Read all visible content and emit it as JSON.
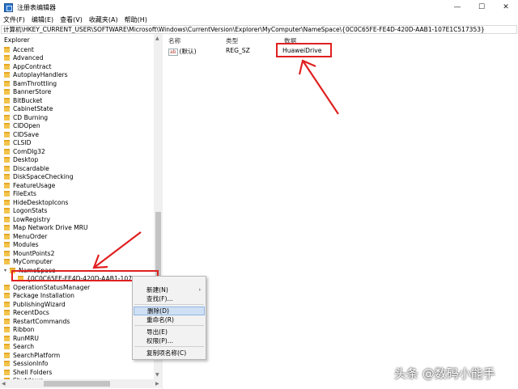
{
  "window": {
    "title": "注册表编辑器",
    "minimize": "—",
    "maximize": "☐",
    "close": "✕"
  },
  "menu": [
    "文件(F)",
    "编辑(E)",
    "查看(V)",
    "收藏夹(A)",
    "帮助(H)"
  ],
  "address": "计算机\\HKEY_CURRENT_USER\\SOFTWARE\\Microsoft\\Windows\\CurrentVersion\\Explorer\\MyComputer\\NameSpace\\{0C0C65FE-FE4D-420D-AAB1-107E1C517353}",
  "tree": {
    "root": "Explorer",
    "items_before": [
      "Accent",
      "Advanced",
      "AppContract",
      "AutoplayHandlers",
      "BamThrottling",
      "BannerStore",
      "BitBucket",
      "CabinetState",
      "CD Burning",
      "CIDOpen",
      "CIDSave",
      "CLSID",
      "ComDlg32",
      "Desktop",
      "Discardable",
      "DiskSpaceChecking",
      "FeatureUsage",
      "FileExts",
      "HideDesktopIcons",
      "LogonStats",
      "LowRegistry",
      "Map Network Drive MRU",
      "MenuOrder",
      "Modules",
      "MountPoints2"
    ],
    "mycomputer": "MyComputer",
    "namespace": "NameSpace",
    "selected_key": "{0C0C65FE-FE4D-420D-AAB1-107E1C",
    "selected_key_tail": "删除",
    "items_after": [
      "OperationStatusManager",
      "Package Installation",
      "PublishingWizard",
      "RecentDocs",
      "RestartCommands",
      "Ribbon",
      "RunMRU",
      "Search",
      "SearchPlatform",
      "SessionInfo",
      "Shell Folders",
      "Shutdown"
    ]
  },
  "list": {
    "headers": {
      "name": "名称",
      "type": "类型",
      "data": "数据"
    },
    "row": {
      "name": "(默认)",
      "type": "REG_SZ",
      "data": "HuaweiDrive"
    },
    "icon_text": "ab"
  },
  "context_menu": {
    "new": "新建(N)",
    "find": "查找(F)...",
    "delete": "删除(D)",
    "rename": "重命名(R)",
    "export": "导出(E)",
    "permissions": "权限(P)...",
    "copy_key_name": "复制项名称(C)",
    "submenu_arrow": "›"
  },
  "watermark": "头条 @数码小能手",
  "colors": {
    "annotation": "#e02020",
    "folder": "#f3c44c",
    "selection": "#cfe0f4"
  }
}
